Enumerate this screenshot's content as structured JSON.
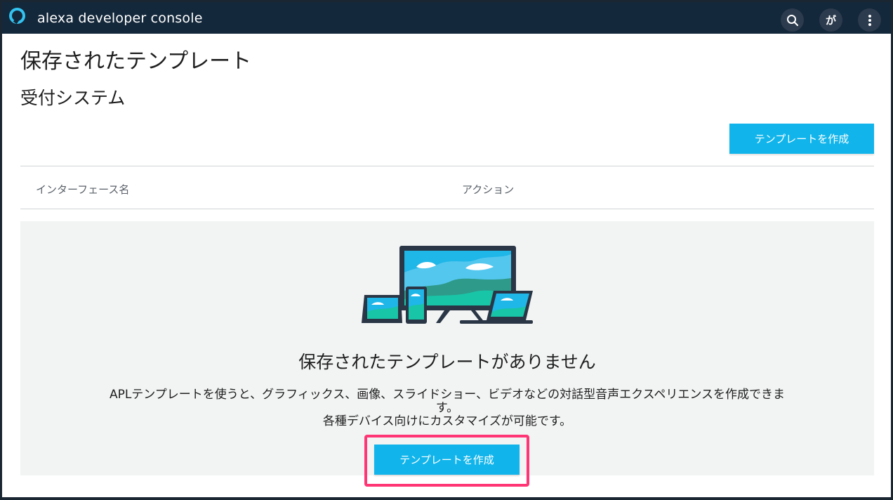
{
  "app": {
    "brand": "alexa developer console"
  },
  "header": {
    "search_icon": "search-icon",
    "language_label": "が",
    "more_icon": "more-vertical-icon"
  },
  "page": {
    "title": "保存されたテンプレート",
    "subtitle": "受付システム",
    "create_button_label": "テンプレートを作成"
  },
  "table": {
    "columns": [
      "インターフェース名",
      "アクション"
    ]
  },
  "empty_state": {
    "title": "保存されたテンプレートがありません",
    "description_lines": [
      "APLテンプレートを使うと、グラフィックス、画像、スライドショー、ビデオなどの対話型音声エクスペリエンスを作成できま",
      "す。",
      "各種デバイス向けにカスタマイズが可能です。"
    ],
    "create_button_label": "テンプレートを作成",
    "highlight_color": "#ff3575"
  },
  "colors": {
    "header_bg": "#14283b",
    "accent": "#11b5eb",
    "logo": "#33c3f0"
  }
}
